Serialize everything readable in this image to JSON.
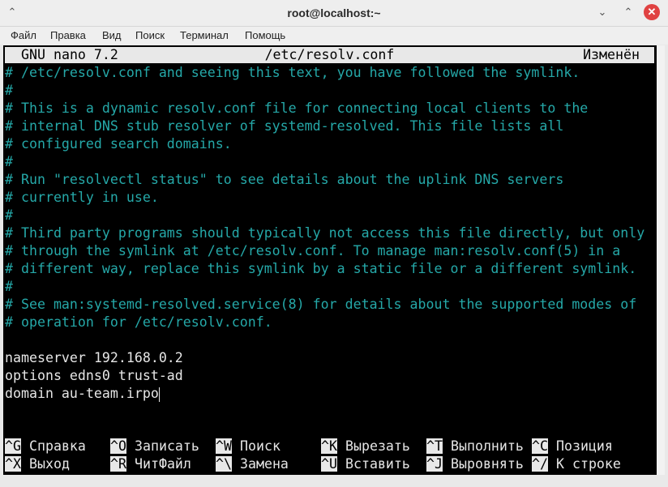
{
  "window": {
    "title": "root@localhost:~",
    "menu_icon": "pin-icon",
    "minimize_icon": "minimize-icon",
    "maximize_icon": "maximize-icon",
    "close_icon": "close-icon"
  },
  "menubar": {
    "items": [
      "Файл",
      "Правка",
      "Вид",
      "Поиск",
      "Терминал",
      "Помощь"
    ]
  },
  "nano": {
    "version": "GNU nano 7.2",
    "filename": "/etc/resolv.conf",
    "status": "Изменён"
  },
  "editor": {
    "lines": [
      "# /etc/resolv.conf and seeing this text, you have followed the symlink.",
      "#",
      "# This is a dynamic resolv.conf file for connecting local clients to the",
      "# internal DNS stub resolver of systemd-resolved. This file lists all",
      "# configured search domains.",
      "#",
      "# Run \"resolvectl status\" to see details about the uplink DNS servers",
      "# currently in use.",
      "#",
      "# Third party programs should typically not access this file directly, but only",
      "# through the symlink at /etc/resolv.conf. To manage man:resolv.conf(5) in a",
      "# different way, replace this symlink by a static file or a different symlink.",
      "#",
      "# See man:systemd-resolved.service(8) for details about the supported modes of",
      "# operation for /etc/resolv.conf.",
      "",
      "nameserver 192.168.0.2",
      "options edns0 trust-ad",
      "domain au-team.irpo"
    ]
  },
  "shortcuts": {
    "row1": [
      {
        "key": "^G",
        "label": "Справка"
      },
      {
        "key": "^O",
        "label": "Записать"
      },
      {
        "key": "^W",
        "label": "Поиск"
      },
      {
        "key": "^K",
        "label": "Вырезать"
      },
      {
        "key": "^T",
        "label": "Выполнить"
      },
      {
        "key": "^C",
        "label": "Позиция"
      }
    ],
    "row2": [
      {
        "key": "^X",
        "label": "Выход"
      },
      {
        "key": "^R",
        "label": "ЧитФайл"
      },
      {
        "key": "^\\",
        "label": "Замена"
      },
      {
        "key": "^U",
        "label": "Вставить"
      },
      {
        "key": "^J",
        "label": "Выровнять"
      },
      {
        "key": "^/",
        "label": "К строке"
      }
    ]
  },
  "colors": {
    "terminal_bg": "#000000",
    "comment": "#25a8a8",
    "text": "#e6e6e6",
    "header_bg": "#e8e8e8",
    "close_button": "#e04242"
  }
}
